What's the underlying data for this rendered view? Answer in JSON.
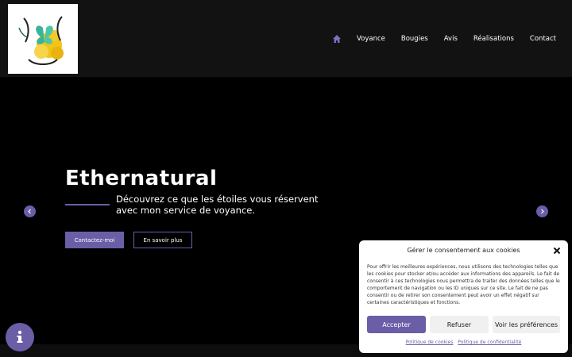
{
  "header": {
    "logo_alt": "Ethernatural",
    "nav": [
      "Voyance",
      "Bougies",
      "Avis",
      "Réalisations",
      "Contact"
    ],
    "home_icon": "home-icon"
  },
  "hero": {
    "title": "Ethernatural",
    "subtitle": "Découvrez ce que les étoiles vous réservent avec mon service de voyance.",
    "primary_button": "Contactez-moi",
    "secondary_button": "En savoir plus",
    "prev_icon": "chevron-left-icon",
    "next_icon": "chevron-right-icon"
  },
  "info_button": {
    "icon": "info-icon"
  },
  "cookie": {
    "title": "Gérer le consentement aux cookies",
    "text": "Pour offrir les meilleures expériences, nous utilisons des technologies telles que les cookies pour stocker et/ou accéder aux informations des appareils. Le fait de consentir à ces technologies nous permettra de traiter des données telles que le comportement de navigation ou les ID uniques sur ce site. Le fait de ne pas consentir ou de retirer son consentement peut avoir un effet négatif sur certaines caractéristiques et fonctions.",
    "accept": "Accepter",
    "refuse": "Refuser",
    "preferences": "Voir les préférences",
    "cookie_policy": "Politique de cookies",
    "privacy_policy": "Politique de confidentialité"
  },
  "colors": {
    "accent": "#6b5ea7",
    "header_bg": "#121212",
    "hero_bg": "#000000"
  }
}
